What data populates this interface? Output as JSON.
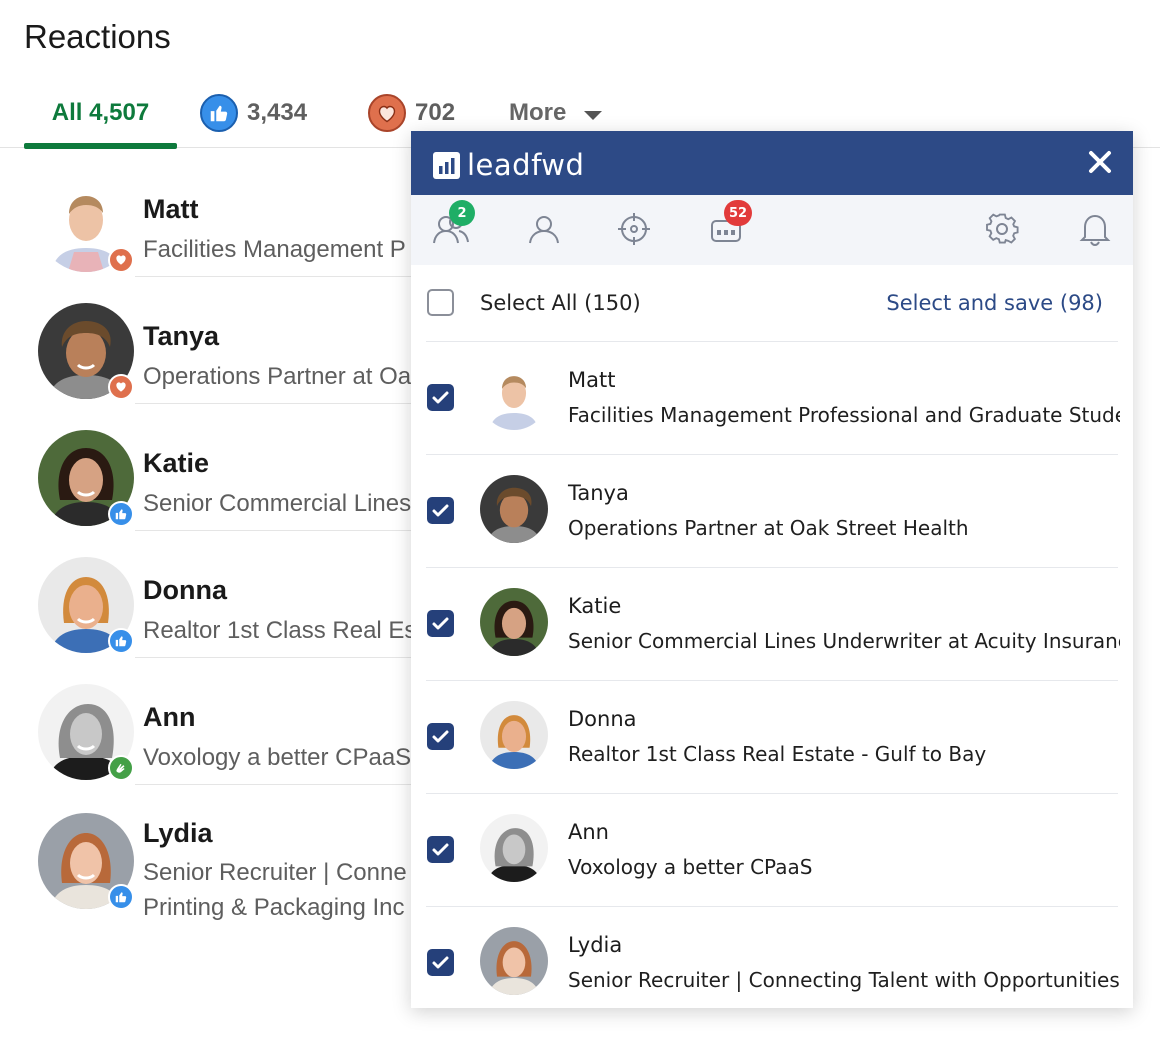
{
  "reactions": {
    "title": "Reactions",
    "tabs": {
      "all": "All 4,507",
      "like_count": "3,434",
      "love_count": "702",
      "more": "More"
    },
    "people": [
      {
        "name": "Matt",
        "headline": "Facilities Management P",
        "headline2": "",
        "reaction": "love"
      },
      {
        "name": "Tanya",
        "headline": "Operations Partner at Oa",
        "headline2": "",
        "reaction": "love"
      },
      {
        "name": "Katie",
        "headline": "Senior Commercial Lines",
        "headline2": "",
        "reaction": "like"
      },
      {
        "name": "Donna",
        "headline": "Realtor 1st Class Real Es",
        "headline2": "",
        "reaction": "like"
      },
      {
        "name": "Ann",
        "headline": "Voxology a better CPaaS",
        "headline2": "",
        "reaction": "celebrate"
      },
      {
        "name": "Lydia",
        "headline": "Senior Recruiter | Conne",
        "headline2": "Printing & Packaging Inc",
        "reaction": "like"
      }
    ]
  },
  "leadfwd": {
    "brand": "leadfwd",
    "toolbar": {
      "contacts_badge": "2",
      "events_badge": "52"
    },
    "select_all": "Select All (150)",
    "select_and_save": "Select and save (98)",
    "contacts": [
      {
        "name": "Matt",
        "headline": "Facilities Management Professional and Graduate Student",
        "checked": true
      },
      {
        "name": "Tanya",
        "headline": "Operations Partner at Oak Street Health",
        "checked": true
      },
      {
        "name": "Katie",
        "headline": "Senior Commercial Lines Underwriter at Acuity Insurance",
        "checked": true
      },
      {
        "name": "Donna",
        "headline": "Realtor 1st Class Real Estate - Gulf to Bay",
        "checked": true
      },
      {
        "name": "Ann",
        "headline": "Voxology a better CPaaS",
        "checked": true
      },
      {
        "name": "Lydia",
        "headline": "Senior Recruiter | Connecting Talent with Opportunities",
        "checked": true
      }
    ]
  },
  "colors": {
    "linkedin_green": "#0e7a3c",
    "like_blue": "#378fe9",
    "love_red": "#df704d",
    "celebrate_green": "#44a047",
    "leadfwd_navy": "#2d4a86",
    "badge_green": "#1fae66",
    "badge_red": "#e23b3b"
  },
  "icons": {
    "like": "thumbs-up-icon",
    "love": "heart-icon",
    "celebrate": "clapping-hands-icon",
    "toolbar": [
      "contacts-icon",
      "person-icon",
      "target-icon",
      "events-icon",
      "settings-icon",
      "bell-icon"
    ]
  }
}
